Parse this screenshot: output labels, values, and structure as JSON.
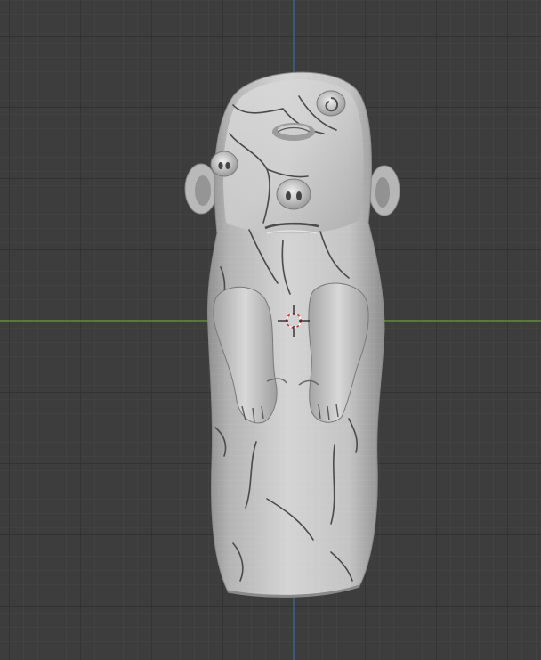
{
  "viewport": {
    "mode": "sculpt-viewport",
    "background_color": "#3d3d3d",
    "grid_minor_color": "#474747",
    "grid_major_color": "#2e2e2e",
    "x_axis_color": "#6f9b33",
    "y_axis_color": "#3e63a8",
    "cursor_color": "#d23c3c",
    "mesh_base_color": "#c6c6c6",
    "mesh_shadow_color": "#8e8e8e",
    "mesh_highlight_color": "#e2e2e2",
    "crack_color": "#3f3f3f"
  },
  "object": {
    "name_icon": "sculpted-figurine",
    "features": [
      "head",
      "left-ear",
      "right-ear",
      "cyclops-eye",
      "spiral-eye",
      "snout-left",
      "snout-center",
      "mouth",
      "left-arm",
      "right-arm",
      "torso",
      "cracks"
    ]
  },
  "cursor": {
    "icon": "3d-cursor-icon"
  }
}
